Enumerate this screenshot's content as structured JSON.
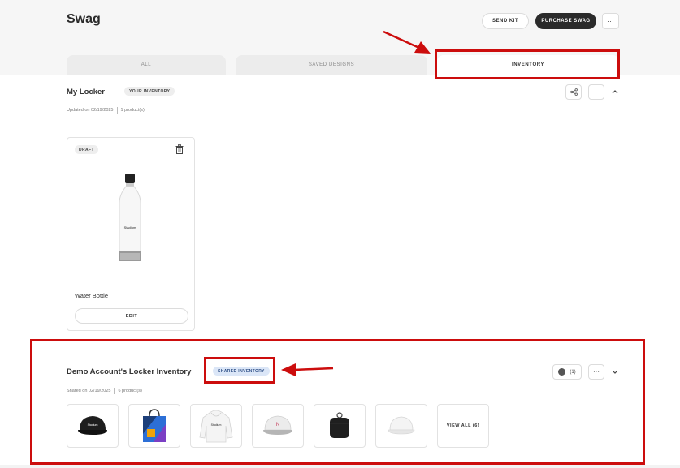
{
  "header": {
    "title": "Swag",
    "send_kit_label": "SEND KIT",
    "purchase_label": "PURCHASE SWAG",
    "more_label": "···"
  },
  "tabs": [
    {
      "label": "ALL"
    },
    {
      "label": "SAVED DESIGNS"
    },
    {
      "label": "INVENTORY",
      "active": true
    }
  ],
  "my_locker": {
    "title": "My Locker",
    "badge": "YOUR INVENTORY",
    "updated": "Updated on 02/19/2025",
    "count": "1 product(s)",
    "more_label": "···",
    "product": {
      "status": "DRAFT",
      "name": "Water Bottle",
      "bottle_text": "Stadium",
      "edit_label": "EDIT"
    }
  },
  "shared_locker": {
    "title": "Demo Account's Locker Inventory",
    "badge": "SHARED INVENTORY",
    "shared": "Shared on 02/19/2025",
    "count": "6 product(s)",
    "members": "(1)",
    "more_label": "···",
    "cap_text": "Stadium",
    "hoodie_text": "Stadium",
    "view_all_label": "VIEW ALL (6)"
  },
  "colors": {
    "accent_dark": "#2b2b2b",
    "annotation_red": "#cc0d0d",
    "shared_badge_bg": "#dbe6f7"
  }
}
